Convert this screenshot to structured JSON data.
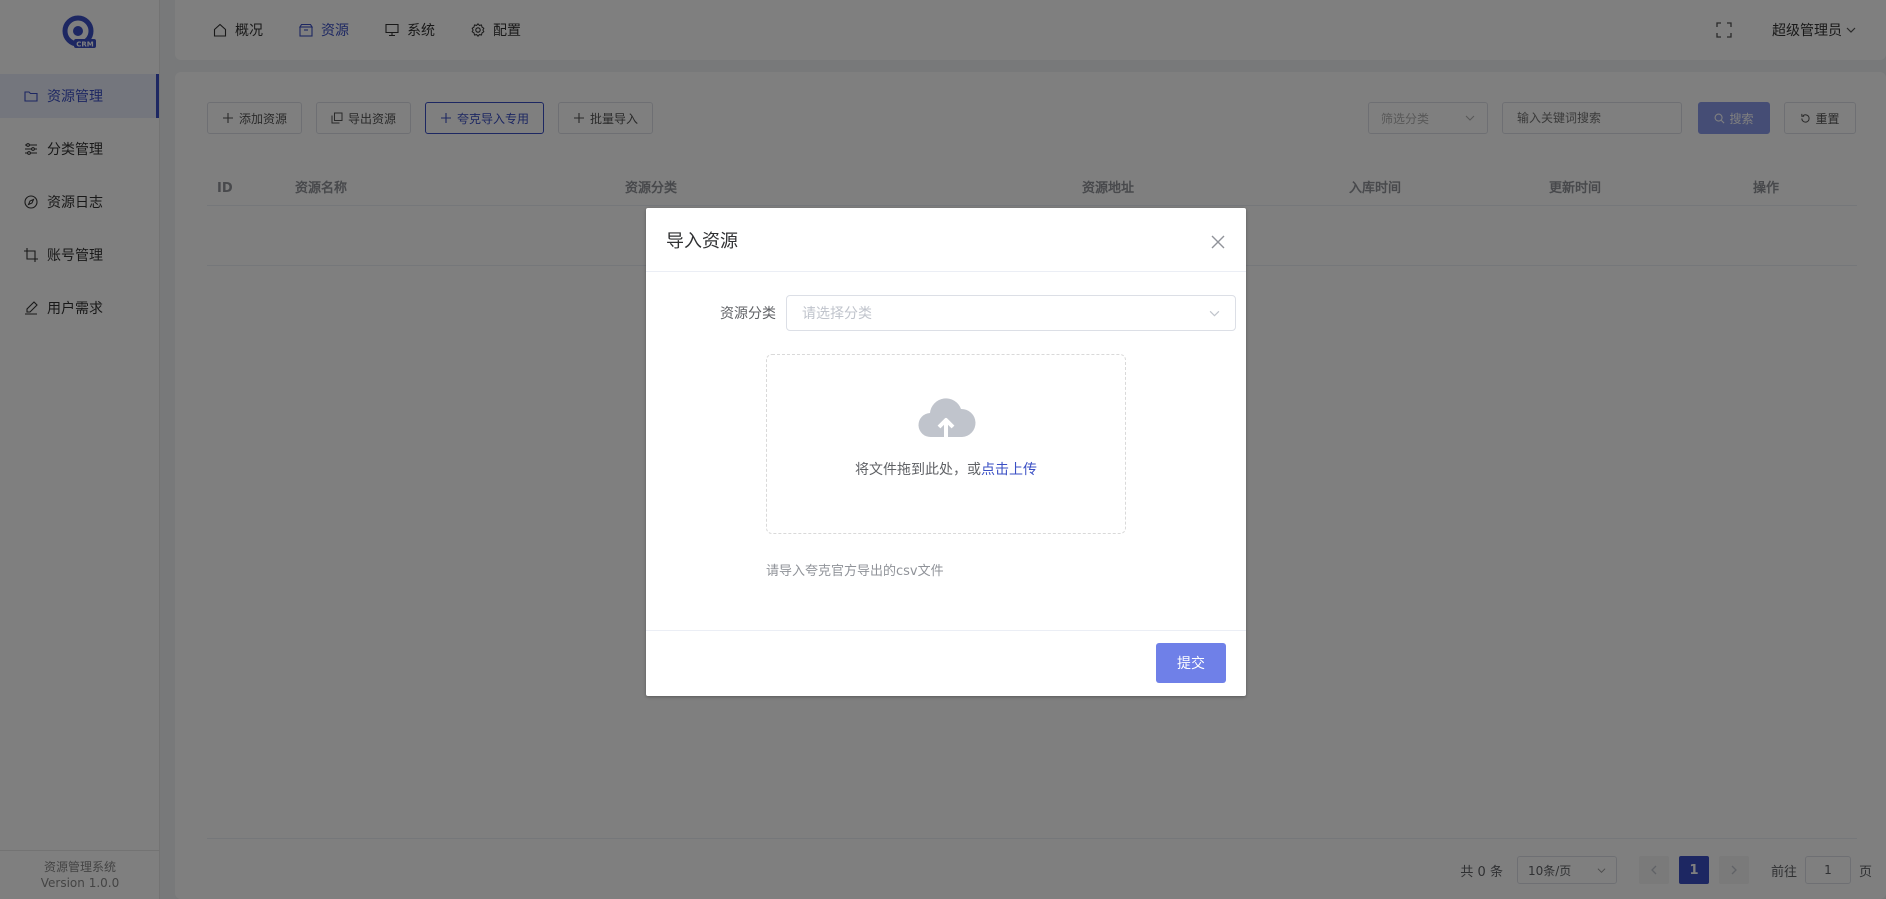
{
  "sidebar": {
    "items": [
      {
        "label": "资源管理",
        "icon": "folder-icon",
        "active": true
      },
      {
        "label": "分类管理",
        "icon": "sliders-icon",
        "active": false
      },
      {
        "label": "资源日志",
        "icon": "compass-icon",
        "active": false
      },
      {
        "label": "账号管理",
        "icon": "crop-icon",
        "active": false
      },
      {
        "label": "用户需求",
        "icon": "pen-icon",
        "active": false
      }
    ],
    "footer_title": "资源管理系统",
    "footer_version": "Version 1.0.0"
  },
  "topnav": {
    "items": [
      {
        "label": "概况",
        "icon": "home-icon"
      },
      {
        "label": "资源",
        "icon": "box-icon"
      },
      {
        "label": "系统",
        "icon": "monitor-icon"
      },
      {
        "label": "配置",
        "icon": "gear-icon"
      }
    ],
    "active_index": 1,
    "user": "超级管理员"
  },
  "toolbar": {
    "add": "添加资源",
    "export": "导出资源",
    "quark_import": "夸克导入专用",
    "batch_import": "批量导入"
  },
  "filters": {
    "category_placeholder": "筛选分类",
    "keyword_placeholder": "输入关键词搜索",
    "search": "搜索",
    "reset": "重置"
  },
  "table": {
    "columns": [
      "ID",
      "资源名称",
      "资源分类",
      "资源地址",
      "入库时间",
      "更新时间",
      "操作"
    ]
  },
  "pagination": {
    "total": "共 0 条",
    "page_size": "10条/页",
    "current": "1",
    "goto_label": "前往",
    "goto_value": "1",
    "page_suffix": "页"
  },
  "dialog": {
    "title": "导入资源",
    "category_label": "资源分类",
    "category_placeholder": "请选择分类",
    "upload_text": "将文件拖到此处，或",
    "upload_link": "点击上传",
    "tip": "请导入夸克官方导出的csv文件",
    "submit": "提交"
  },
  "colors": {
    "accent": "#3a4fc4",
    "submit": "#6f80e8"
  }
}
